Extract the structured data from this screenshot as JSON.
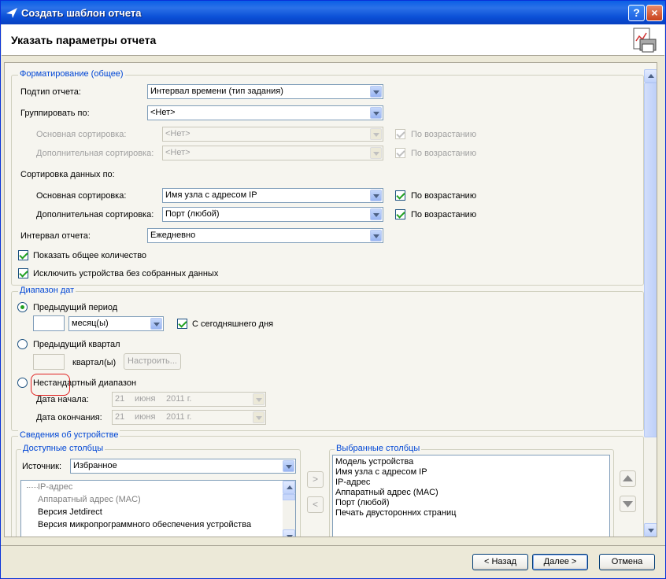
{
  "window": {
    "title": "Создать шаблон отчета",
    "help_label": "?",
    "close_label": "×"
  },
  "header": {
    "title": "Указать параметры отчета"
  },
  "formatting": {
    "group_title": "Форматирование (общее)",
    "subtype_label": "Подтип отчета:",
    "subtype_value": "Интервал времени (тип задания)",
    "groupby_label": "Группировать по:",
    "groupby_value": "<Нет>",
    "primary_sort_label": "Основная сортировка:",
    "primary_sort_value": "<Нет>",
    "secondary_sort_label": "Дополнительная сортировка:",
    "secondary_sort_value": "<Нет>",
    "ascending_label": "По возрастанию",
    "data_sort_label": "Сортировка данных по:",
    "data_primary_sort_label": "Основная сортировка:",
    "data_primary_sort_value": "Имя узла с адресом IP",
    "data_secondary_sort_label": "Дополнительная сортировка:",
    "data_secondary_sort_value": "Порт (любой)",
    "interval_label": "Интервал отчета:",
    "interval_value": "Ежедневно",
    "show_total_label": "Показать общее количество",
    "exclude_devices_label": "Исключить устройства без собранных данных"
  },
  "date_range": {
    "group_title": "Диапазон дат",
    "prev_period_label": "Предыдущий период",
    "period_count_value": "",
    "period_unit_value": "месяц(ы)",
    "from_today_label": "С сегодняшнего дня",
    "prev_quarter_label": "Предыдущий квартал",
    "quarter_unit_label": "квартал(ы)",
    "configure_label": "Настроить...",
    "custom_range_label": "Нестандартный диапазон",
    "start_date_label": "Дата начала:",
    "end_date_label": "Дата окончания:",
    "start_day": "21",
    "start_month": "июня",
    "start_year": "2011 г.",
    "end_day": "21",
    "end_month": "июня",
    "end_year": "2011 г."
  },
  "device_info": {
    "group_title": "Сведения об устройстве",
    "available_title": "Доступные столбцы",
    "source_label": "Источник:",
    "source_value": "Избранное",
    "available_columns": [
      "IP-адрес",
      "Аппаратный адрес (MAC)",
      "Версия Jetdirect",
      "Версия микропрограммного обеспечения устройства"
    ],
    "selected_title": "Выбранные столбцы",
    "selected_columns": [
      "Модель устройства",
      "Имя узла с адресом IP",
      "IP-адрес",
      "Аппаратный адрес (MAC)",
      "Порт (любой)",
      "Печать двусторонних страниц"
    ],
    "add_label": ">",
    "remove_label": "<"
  },
  "footer": {
    "back_label": "< Назад",
    "next_label": "Далее >",
    "cancel_label": "Отмена"
  }
}
